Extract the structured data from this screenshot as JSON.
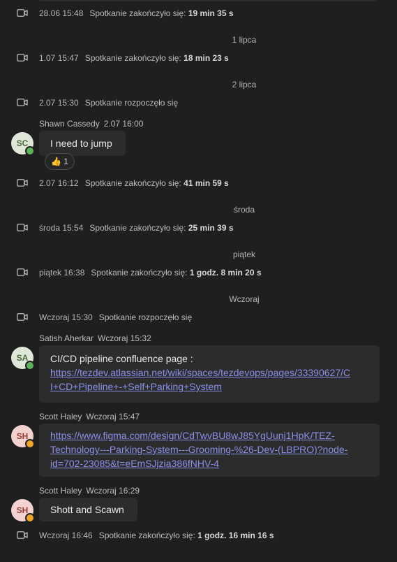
{
  "events": [
    {
      "time": "28.06 15:48",
      "text": "Spotkanie zakończyło się:",
      "duration": "19 min 35 s"
    },
    {
      "time": "1.07 15:47",
      "text": "Spotkanie zakończyło się:",
      "duration": "18 min 23 s"
    },
    {
      "time": "2.07 15:30",
      "text": "Spotkanie rozpoczęło się",
      "duration": ""
    },
    {
      "time": "2.07 16:12",
      "text": "Spotkanie zakończyło się:",
      "duration": "41 min 59 s"
    },
    {
      "time": "środa 15:54",
      "text": "Spotkanie zakończyło się:",
      "duration": "25 min 39 s"
    },
    {
      "time": "piątek 16:38",
      "text": "Spotkanie zakończyło się:",
      "duration": "1 godz. 8 min 20 s"
    },
    {
      "time": "Wczoraj 15:30",
      "text": "Spotkanie rozpoczęło się",
      "duration": ""
    },
    {
      "time": "Wczoraj 16:46",
      "text": "Spotkanie zakończyło się:",
      "duration": "1 godz. 16 min 16 s"
    }
  ],
  "dividers": [
    "1 lipca",
    "2 lipca",
    "środa",
    "piątek",
    "Wczoraj"
  ],
  "messages": [
    {
      "initials": "SC",
      "name": "Shawn Cassedy",
      "time": "2.07 16:00",
      "text": "I need to jump",
      "reaction_emoji": "👍",
      "reaction_count": "1"
    },
    {
      "initials": "SA",
      "name": "Satish Aherkar",
      "time": "Wczoraj 15:32",
      "text": "CI/CD pipeline confluence page :",
      "link": "https://tezdev.atlassian.net/wiki/spaces/tezdevops/pages/33390627/CI+CD+Pipeline+-+Self+Parking+System",
      "link_lines": [
        "https://tezdev.atlassian.net/wiki/spaces/tezdevops/pages/33390627/C",
        "I+CD+Pipeline+-+Self+Parking+System"
      ]
    },
    {
      "initials": "SH",
      "name": "Scott Haley",
      "time": "Wczoraj 15:47",
      "link": "https://www.figma.com/design/CdTwvBU8wJ85YgUunj1HpK/TEZ-Technology---Parking-System---Grooming-%26-Dev-(LBPRO)?node-id=702-23085&t=eEmSJjzia386fNHV-4",
      "link_lines": [
        "https://www.figma.com/design/CdTwvBU8wJ85YgUunj1HpK/TEZ-",
        "Technology---Parking-System---Grooming-%26-Dev-(LBPRO)?node-",
        "id=702-23085&t=eEmSJjzia386fNHV-4"
      ]
    },
    {
      "initials": "SH",
      "name": "Scott Haley",
      "time": "Wczoraj 16:29",
      "text": "Shott and Scawn"
    }
  ],
  "icons": {
    "event": "video-camera-icon",
    "presence_available": "check-icon",
    "presence_away": "clock-icon"
  },
  "colors": {
    "background": "#1f1f1f",
    "bubble": "#2c2c2c",
    "link": "#8b90e8",
    "available": "#5bb35a",
    "away": "#f0a52a"
  }
}
